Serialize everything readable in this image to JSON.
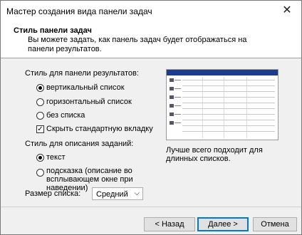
{
  "window": {
    "title": "Мастер создания вида панели задач"
  },
  "header": {
    "title": "Стиль панели задач",
    "subtitle": "Вы можете задать, как панель задач будет отображаться на панели результатов."
  },
  "results_pane": {
    "group_label": "Стиль для панели результатов:",
    "options": [
      "вертикальный список",
      "горизонтальный список",
      "без списка"
    ],
    "selected": "вертикальный список",
    "hide_tab_label": "Скрыть стандартную вкладку",
    "hide_tab_checked": true
  },
  "description": {
    "group_label": "Стиль для описания заданий:",
    "options": [
      "текст",
      "подсказка (описание во всплывающем окне при наведении)"
    ],
    "selected": "текст"
  },
  "list_size": {
    "label": "Размер списка:",
    "value": "Средний"
  },
  "preview": {
    "caption": "Лучше всего подходит для длинных списков."
  },
  "buttons": {
    "back": "< Назад",
    "next": "Далее >",
    "cancel": "Отмена"
  }
}
